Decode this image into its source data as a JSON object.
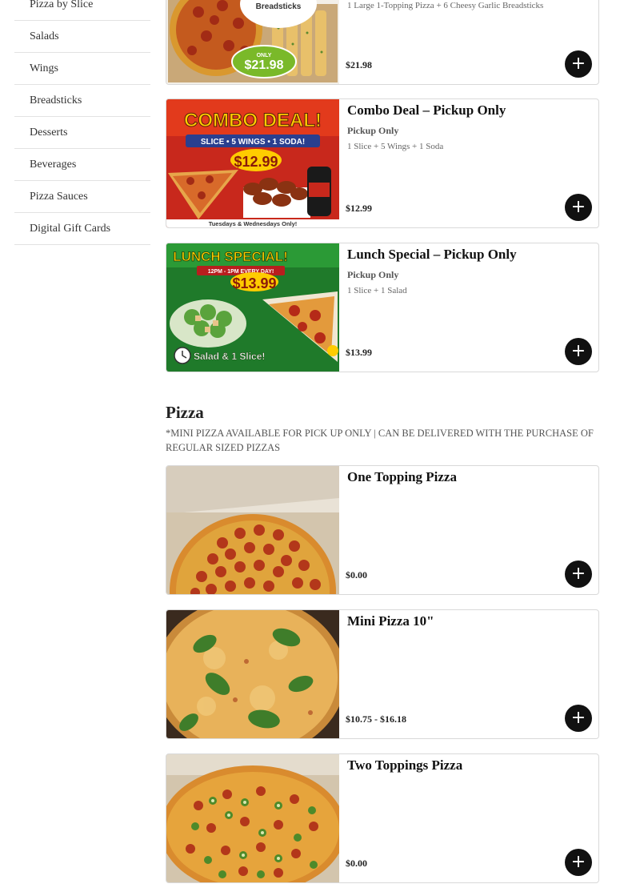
{
  "sidebar": {
    "items": [
      {
        "label": "Pizza by Slice"
      },
      {
        "label": "Salads"
      },
      {
        "label": "Wings"
      },
      {
        "label": "Breadsticks"
      },
      {
        "label": "Desserts"
      },
      {
        "label": "Beverages"
      },
      {
        "label": "Pizza Sauces"
      },
      {
        "label": "Digital Gift Cards"
      }
    ]
  },
  "deals": [
    {
      "title": "",
      "subtitle": "",
      "description": "1 Large 1-Topping Pizza + 6 Cheesy Garlic Breadsticks",
      "price": "$21.98",
      "add": "+",
      "img": {
        "badge_top": "ONLY",
        "badge_price": "$21.98",
        "label": "Breadsticks"
      }
    },
    {
      "title": "Combo Deal – Pickup Only",
      "subtitle": "Pickup Only",
      "description": "1 Slice + 5 Wings + 1 Soda",
      "price": "$12.99",
      "add": "+",
      "img": {
        "headline": "COMBO DEAL!",
        "tagline": "SLICE • 5 WINGS • 1 SODA!",
        "price": "$12.99",
        "footer": "Tuesdays & Wednesdays Only!"
      }
    },
    {
      "title": "Lunch Special – Pickup Only",
      "subtitle": "Pickup Only",
      "description": "1 Slice + 1 Salad",
      "price": "$13.99",
      "add": "+",
      "img": {
        "headline": "LUNCH SPECIAL!",
        "tagline": "12PM - 1PM EVERY DAY!",
        "price": "$13.99",
        "footer": "Salad & 1 Slice!"
      }
    }
  ],
  "pizza_section": {
    "title": "Pizza",
    "note": "*MINI PIZZA AVAILABLE FOR PICK UP ONLY | CAN BE DELIVERED WITH THE PURCHASE OF REGULAR SIZED PIZZAS",
    "items": [
      {
        "title": "One Topping Pizza",
        "price": "$0.00",
        "add": "+"
      },
      {
        "title": "Mini Pizza 10\"",
        "price": "$10.75 - $16.18",
        "add": "+"
      },
      {
        "title": "Two Toppings Pizza",
        "price": "$0.00",
        "add": "+"
      }
    ]
  },
  "colors": {
    "button": "#111111",
    "border": "#d9d9d9",
    "promo_red": "#c8281c",
    "promo_yellow": "#ffcc00",
    "promo_green": "#1f7a2a"
  }
}
